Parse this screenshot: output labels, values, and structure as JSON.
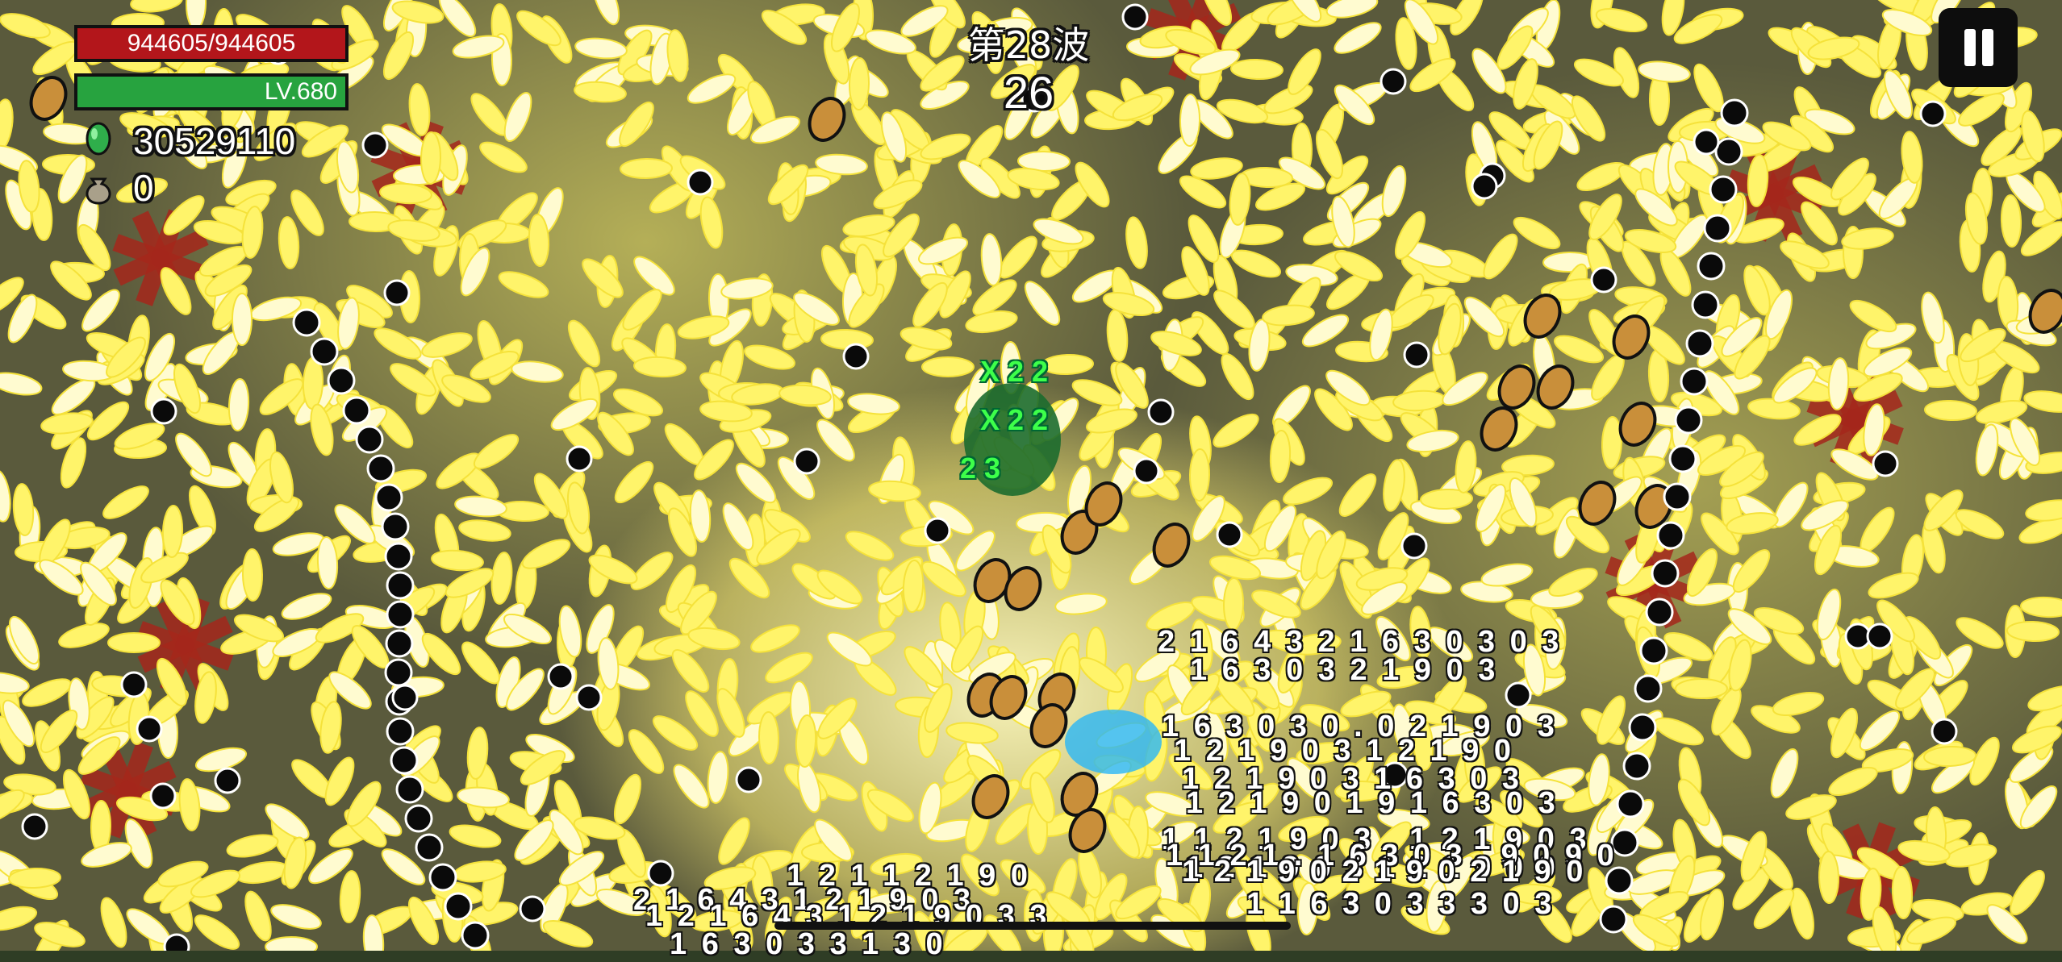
{
  "hud": {
    "hp_text": "944605/944605",
    "level_text": "LV.680",
    "gem_count": "30529110",
    "bag_count": "0",
    "wave_label": "第28波",
    "wave_timer": "26",
    "pause_icon": "pause-icon",
    "gem_icon": "green-gem-icon",
    "bag_icon": "money-bag-icon"
  },
  "colors": {
    "hp": "#b3161b",
    "level": "#27a33f",
    "projectile": "#fff46a",
    "green_text": "#3dff4a"
  },
  "damage_numbers": {
    "white": [
      "2 1 6 4 3 2 1 6 3 0 3 0 3",
      "1 6 3 0 3 2 1 9 0 3",
      "1 6 3 0 3 0 . 0 2 1 9 0 3",
      "1 2 1 9 0 3 1 2 1 9 0",
      "1 2 1 9 0 3 1 6 3 0 3",
      "1 2 1 9 0 1 9 1 6 3 0 3",
      "1 1 2 1 9 0 3 . 1 2 1 9 0 3",
      "1 2 1 9 0 3 1 2 1 9 0 0",
      "1 1 2 1 . 1 6 3 0 3 . 9 0 9 0",
      "1 2 1 9 0 2 1 9 0 2 1 9 0",
      "1 1 6 3 0 3 3 3 0 3",
      "1 2 1 1 2 1 9 0",
      "2 1 6 4 3 1 2 1 9 0 3",
      "1 2 1 6 4 3 1 2 1 9 0 3 3",
      "1 6 3 0 3 3 1 3 0"
    ],
    "green": [
      "X 2 2",
      "X 2 2",
      "2 3"
    ]
  }
}
